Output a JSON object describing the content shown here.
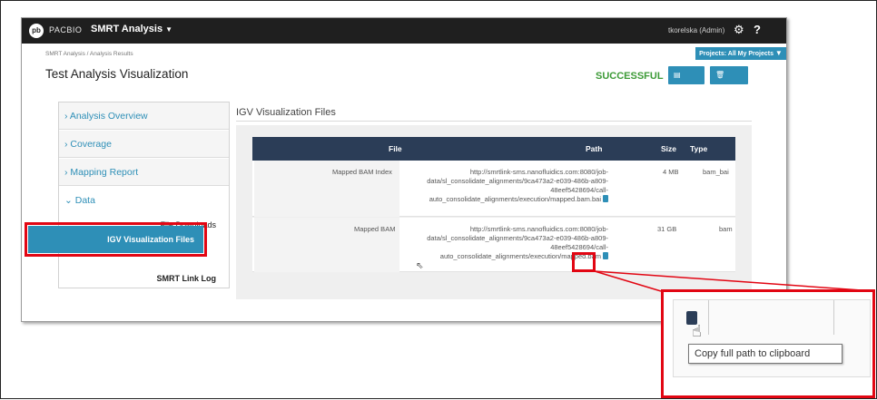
{
  "header": {
    "logo": "pb",
    "brand": "PACBIO",
    "app_name": "SMRT Analysis",
    "user": "tkorelska (Admin)"
  },
  "breadcrumb": "SMRT Analysis / Analysis Results",
  "projects_selector": "Projects: All My Projects",
  "page_title": "Test Analysis Visualization",
  "status": "SUCCESSFUL",
  "buttons": {
    "copy": "Copy",
    "delete": "Delete"
  },
  "sidebar": {
    "items": [
      {
        "label": "Analysis Overview",
        "expanded": false
      },
      {
        "label": "Coverage",
        "expanded": false
      },
      {
        "label": "Mapping Report",
        "expanded": false
      },
      {
        "label": "Data",
        "expanded": true
      }
    ],
    "sub_items": [
      "File Downloads",
      "IGV Visualization Files",
      "SMRT Link Log"
    ],
    "active": "IGV Visualization Files"
  },
  "section_title": "IGV Visualization Files",
  "table": {
    "columns": [
      "File",
      "Path",
      "Size",
      "Type"
    ],
    "rows": [
      {
        "file": "Mapped BAM Index",
        "path_lines": [
          "http://smrtlink-sms.nanofluidics.com:8080/job-",
          "data/sl_consolidate_alignments/9ca473a2-e039-486b-a809-",
          "48eef5428694/call-",
          "auto_consolidate_alignments/execution/mapped.bam.bai"
        ],
        "size": "4 MB",
        "type": "bam_bai"
      },
      {
        "file": "Mapped BAM",
        "path_lines": [
          "http://smrtlink-sms.nanofluidics.com:8080/job-",
          "data/sl_consolidate_alignments/9ca473a2-e039-486b-a809-",
          "48eef5428694/call-",
          "auto_consolidate_alignments/execution/mapped.bam"
        ],
        "size": "31 GB",
        "type": "bam"
      }
    ]
  },
  "tooltip": "Copy full path to clipboard",
  "colors": {
    "accent": "#2e8fb7",
    "table_header": "#2b3d57",
    "success": "#3c9a36",
    "highlight": "#e20613",
    "topbar": "#1f1f1f"
  }
}
